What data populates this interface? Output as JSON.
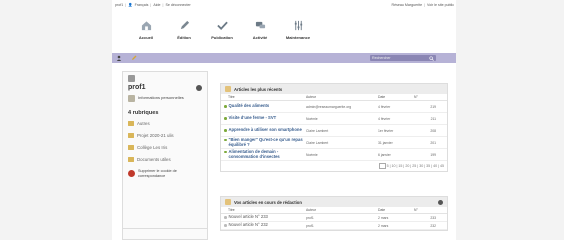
{
  "topbar": {
    "user": "prof1",
    "icon": "user-admin-icon",
    "lang": "Français",
    "help": "Aide",
    "logout": "Se déconnecter",
    "site": "Réseau Marguerite",
    "visit": "Voir le site public"
  },
  "toolbar": [
    {
      "label": "Accueil",
      "icon": "home-icon"
    },
    {
      "label": "Édition",
      "icon": "pencil-icon"
    },
    {
      "label": "Publication",
      "icon": "checkmark-icon"
    },
    {
      "label": "Activité",
      "icon": "chat-bubbles-icon"
    },
    {
      "label": "Maintenance",
      "icon": "sliders-icon"
    }
  ],
  "search": {
    "placeholder": "Rechercher"
  },
  "sidebar": {
    "user": "prof1",
    "info": "Informations personnelles",
    "rubriques_title": "4 rubriques",
    "rubriques": [
      "Autres",
      "Projet 2020-21 ulis",
      "Collège Les Iris",
      "Documents utiles"
    ],
    "delete": "Supprimer le cookie de correspondance",
    "bottom": "Réseau Marguerite"
  },
  "recent": {
    "title": "Articles les plus récents",
    "headers": [
      "Titre",
      "Auteur",
      "Date",
      "N°"
    ],
    "rows": [
      {
        "title": "Qualité des aliments",
        "author": "admin@reseaumarguerite.org",
        "date": "4 février",
        "num": "219"
      },
      {
        "title": "Visite d'une ferme - SVT",
        "author": "Noémie",
        "date": "4 février",
        "num": "211"
      },
      {
        "title": "Apprendre à utiliser son smartphone",
        "author": "Claire Lambert",
        "date": "1er février",
        "num": "208"
      },
      {
        "title": "\"Bien manger\" Qu'est-ce qu'un repas équilibré ?",
        "author": "Claire Lambert",
        "date": "31 janvier",
        "num": "201"
      },
      {
        "title": "Alimentation de demain - consommation d'insectes",
        "author": "Noémie",
        "date": "6 janvier",
        "num": "199"
      }
    ],
    "pager": "5 | 10 | 15 | 20 | 25 | 30 | 35 | 40 | 45"
  },
  "drafts": {
    "title": "Vos articles en cours de rédaction",
    "headers": [
      "Titre",
      "Auteur",
      "Date",
      "N°"
    ],
    "rows": [
      {
        "title": "Nouvel article N° 233",
        "author": "prof1",
        "date": "2 mars",
        "num": "233"
      },
      {
        "title": "Nouvel article N° 232",
        "author": "prof1",
        "date": "2 mars",
        "num": "232"
      }
    ]
  }
}
